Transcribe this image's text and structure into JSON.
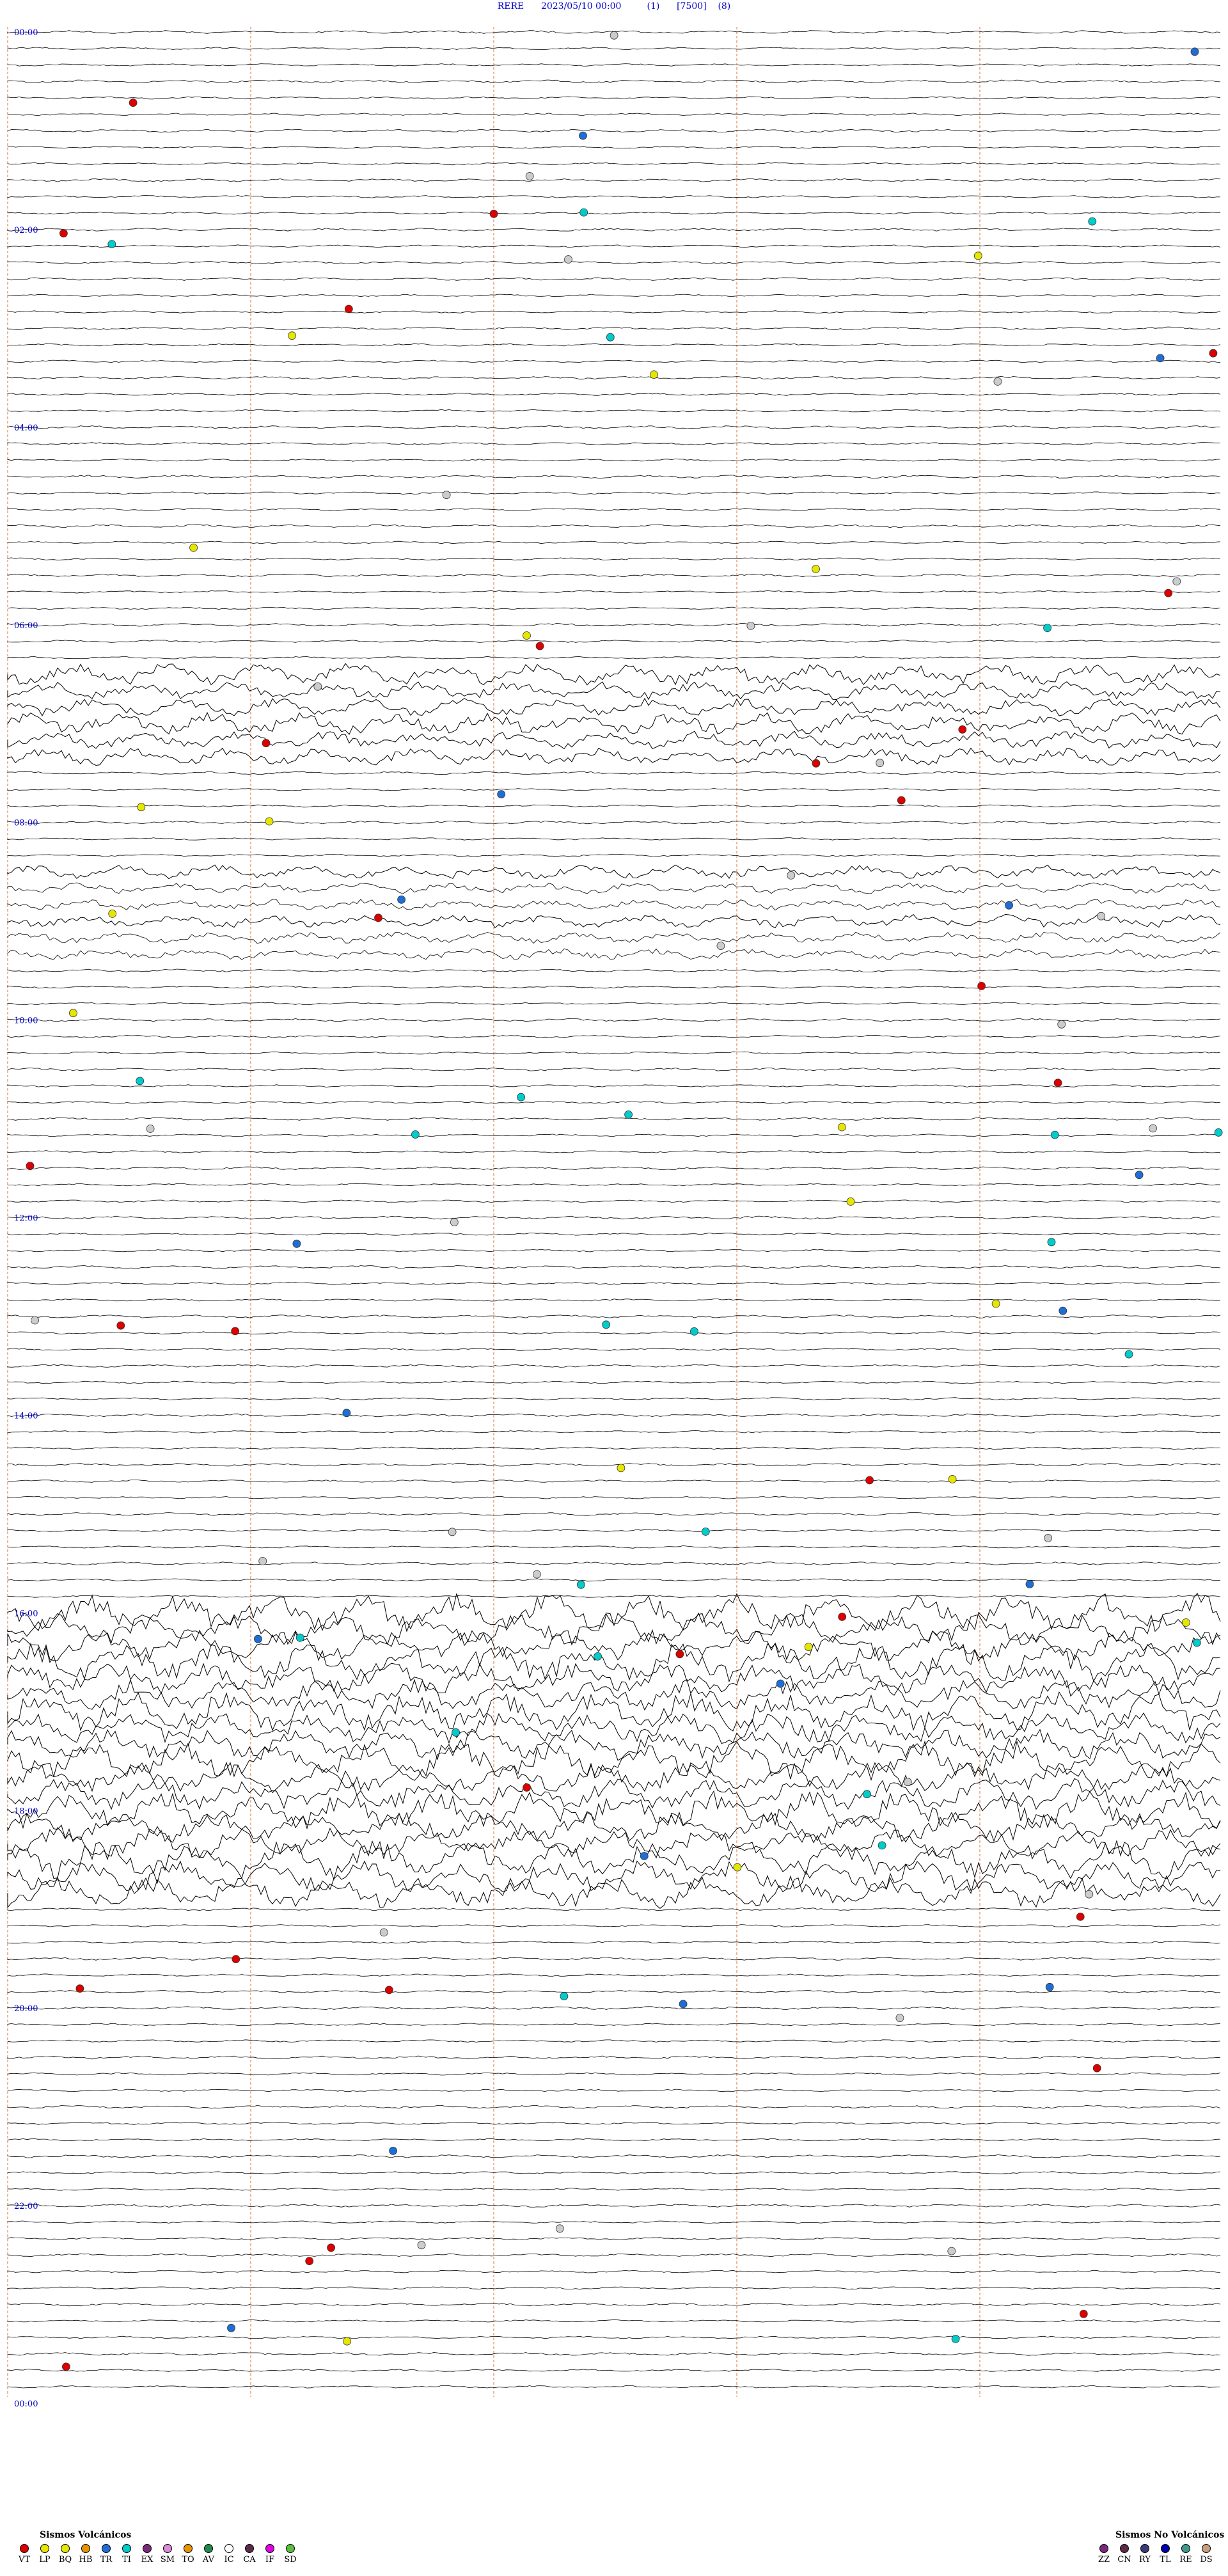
{
  "header": {
    "station": "RERE",
    "datetime": "2023/05/10 00:00",
    "channel": "(1)",
    "amplitude": "[7500]",
    "filter": "(8)"
  },
  "chart_data": {
    "type": "helicorder",
    "hour_labels": [
      "00:00",
      "02:00",
      "04:00",
      "06:00",
      "08:00",
      "10:00",
      "12:00",
      "14:00",
      "16:00",
      "18:00",
      "20:00",
      "22:00",
      "00:00"
    ],
    "x_range_minutes": [
      0,
      30
    ],
    "minute_marks": [
      6,
      12,
      18,
      24
    ],
    "trace_minutes": 30,
    "n_traces": 48,
    "noisy_bands": [
      {
        "hour": 6.5,
        "label": "tremor",
        "intensity": "high"
      },
      {
        "hour": 8.5,
        "label": "burst",
        "intensity": "medium"
      },
      {
        "hour": 16.0,
        "hours_span": 2.5,
        "label": "large-amplitude signal",
        "intensity": "very-high"
      }
    ],
    "event_markers_sample": [
      {
        "type": "TI",
        "color": "#00cccc"
      },
      {
        "type": "VT",
        "color": "#dd0000"
      },
      {
        "type": "LP",
        "color": "#e6e600"
      },
      {
        "type": "IC",
        "color": "#cccccc"
      },
      {
        "type": "TR",
        "color": "#1e6ed6"
      }
    ]
  },
  "legend": {
    "volcanic_title": "Sismos Volcánicos",
    "volcanic_items": [
      {
        "code": "VT",
        "color": "#dd0000"
      },
      {
        "code": "LP",
        "color": "#e6e600"
      },
      {
        "code": "BQ",
        "color": "#e6e600"
      },
      {
        "code": "HB",
        "color": "#e69500"
      },
      {
        "code": "TR",
        "color": "#1e6ed6"
      },
      {
        "code": "TI",
        "color": "#00cccc"
      },
      {
        "code": "EX",
        "color": "#7a2a7a"
      },
      {
        "code": "SM",
        "color": "#d98ad9"
      },
      {
        "code": "TO",
        "color": "#e69500"
      },
      {
        "code": "AV",
        "color": "#1f8a4a"
      },
      {
        "code": "IC",
        "color": "#ffffff"
      },
      {
        "code": "CA",
        "color": "#5a2a4a"
      },
      {
        "code": "IF",
        "color": "#e000e0"
      },
      {
        "code": "SD",
        "color": "#5cbf3c"
      }
    ],
    "nonvolcanic_title": "Sismos No Volcánicos",
    "nonvolcanic_items": [
      {
        "code": "ZZ",
        "color": "#7a2a7a"
      },
      {
        "code": "CN",
        "color": "#5a2a4a"
      },
      {
        "code": "RY",
        "color": "#3a3a7a"
      },
      {
        "code": "TL",
        "color": "#0000aa"
      },
      {
        "code": "RE",
        "color": "#3d9a8a"
      },
      {
        "code": "DS",
        "color": "#c9a07a"
      }
    ]
  },
  "colors": {
    "title_text": "#0000cc",
    "hour_label": "#0000cc",
    "minute_line": "#e6a07a",
    "trace": "#000000"
  }
}
